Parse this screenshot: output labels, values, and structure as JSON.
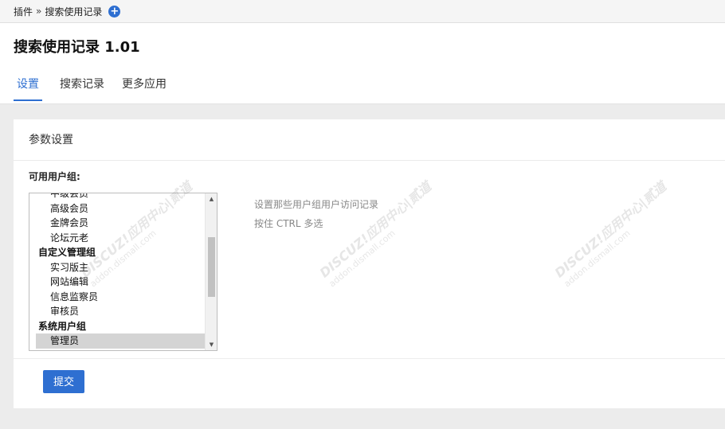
{
  "breadcrumb": {
    "root": "插件",
    "separator": "»",
    "current": "搜索使用记录",
    "add_symbol": "+"
  },
  "page": {
    "title": "搜索使用记录 1.01"
  },
  "tabs": [
    {
      "label": "设置"
    },
    {
      "label": "搜索记录"
    },
    {
      "label": "更多应用"
    }
  ],
  "settings": {
    "section_title": "参数设置",
    "field_label": "可用用户组:",
    "options": [
      {
        "label": "中级会员",
        "type": "item"
      },
      {
        "label": "高级会员",
        "type": "item"
      },
      {
        "label": "金牌会员",
        "type": "item"
      },
      {
        "label": "论坛元老",
        "type": "item"
      },
      {
        "label": "自定义管理组",
        "type": "group"
      },
      {
        "label": "实习版主",
        "type": "item"
      },
      {
        "label": "网站编辑",
        "type": "item"
      },
      {
        "label": "信息监察员",
        "type": "item"
      },
      {
        "label": "审核员",
        "type": "item"
      },
      {
        "label": "系统用户组",
        "type": "group"
      },
      {
        "label": "管理员",
        "type": "item",
        "selected": true
      }
    ],
    "help_line1": "设置那些用户组用户访问记录",
    "help_line2": "按住 CTRL 多选",
    "submit_label": "提交"
  },
  "watermark": {
    "brand": "DISCUZ!应用中心|贰道",
    "url": "addon.dismall.com"
  },
  "colors": {
    "accent": "#2e6fd1",
    "background": "#ececec",
    "card": "#ffffff"
  }
}
